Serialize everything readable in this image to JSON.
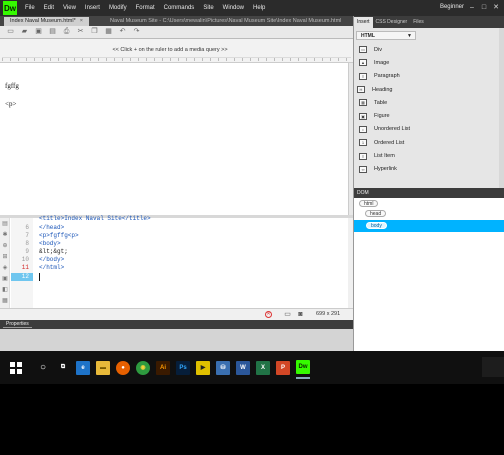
{
  "app": {
    "logo": "Dw",
    "menu": [
      "File",
      "Edit",
      "View",
      "Insert",
      "Modify",
      "Format",
      "Commands",
      "Site",
      "Window",
      "Help"
    ],
    "workspace": "Beginner",
    "window_controls": [
      "–",
      "□",
      "✕"
    ]
  },
  "document": {
    "tab_label": "Index Naval Museum.html*",
    "tab_close": "×",
    "path": "Naval Museum Site - C:\\Users\\mewalin\\Pictures\\Naval Museum Site\\Index Naval Museum.html"
  },
  "toolbar": {
    "icons": [
      "new-file-icon",
      "open-file-icon",
      "save-icon",
      "save-all-icon",
      "print-icon",
      "cut-icon",
      "copy-icon",
      "paste-icon",
      "undo-icon",
      "redo-icon"
    ]
  },
  "media_query_bar": {
    "hint": "<< Click + on the ruler to add a media query >>"
  },
  "live_view": {
    "line1": "fgffg",
    "line2": "<p>"
  },
  "code_view": {
    "lines": [
      {
        "num": "",
        "code": "<title>Index Naval Site</title>"
      },
      {
        "num": "6",
        "code": "</head>"
      },
      {
        "num": "7",
        "code": "<p>fgffg<p>"
      },
      {
        "num": "8",
        "code": "<body>"
      },
      {
        "num": "9",
        "code": "&lt;&gt;"
      },
      {
        "num": "10",
        "code": "</body>"
      },
      {
        "num": "11",
        "code": "</html>"
      },
      {
        "num": "12",
        "code": ""
      }
    ]
  },
  "status_bar": {
    "size": "699 x 291"
  },
  "properties": {
    "tab": "Properties"
  },
  "right_panel": {
    "tabs": [
      "Insert",
      "CSS Designer",
      "Files"
    ],
    "category": "HTML",
    "insert_items": [
      {
        "label": "Div",
        "icon": "div-icon"
      },
      {
        "label": "Image",
        "icon": "image-icon"
      },
      {
        "label": "Paragraph",
        "icon": "paragraph-icon"
      },
      {
        "label": "Heading",
        "icon": "heading-icon"
      },
      {
        "label": "Table",
        "icon": "table-icon"
      },
      {
        "label": "Figure",
        "icon": "figure-icon"
      },
      {
        "label": "Unordered List",
        "icon": "unordered-list-icon"
      },
      {
        "label": "Ordered List",
        "icon": "ordered-list-icon"
      },
      {
        "label": "List Item",
        "icon": "list-item-icon"
      },
      {
        "label": "Hyperlink",
        "icon": "hyperlink-icon"
      }
    ],
    "dom_title": "DOM",
    "dom_nodes": [
      "html",
      "head",
      "body"
    ]
  },
  "taskbar": {
    "apps": [
      {
        "name": "search",
        "glyph": "○",
        "color": "#101010"
      },
      {
        "name": "task-view",
        "glyph": "⧉",
        "color": "#101010"
      },
      {
        "name": "edge",
        "glyph": "e",
        "color": "#1e73c8"
      },
      {
        "name": "file-explorer",
        "glyph": "▬",
        "color": "#e8b93a"
      },
      {
        "name": "firefox",
        "glyph": "●",
        "color": "#e66000"
      },
      {
        "name": "chrome",
        "glyph": "◉",
        "color": "#2e9a3f"
      },
      {
        "name": "illustrator",
        "glyph": "Ai",
        "color": "#3a1a00"
      },
      {
        "name": "photoshop",
        "glyph": "Ps",
        "color": "#061e3a"
      },
      {
        "name": "media-player",
        "glyph": "▶",
        "color": "#e0c000"
      },
      {
        "name": "network",
        "glyph": "⛁",
        "color": "#3a6fb0"
      },
      {
        "name": "word",
        "glyph": "W",
        "color": "#2b579a"
      },
      {
        "name": "excel",
        "glyph": "X",
        "color": "#217346"
      },
      {
        "name": "powerpoint",
        "glyph": "P",
        "color": "#d24726"
      },
      {
        "name": "dreamweaver",
        "glyph": "Dw",
        "color": "#35fa00"
      }
    ]
  }
}
